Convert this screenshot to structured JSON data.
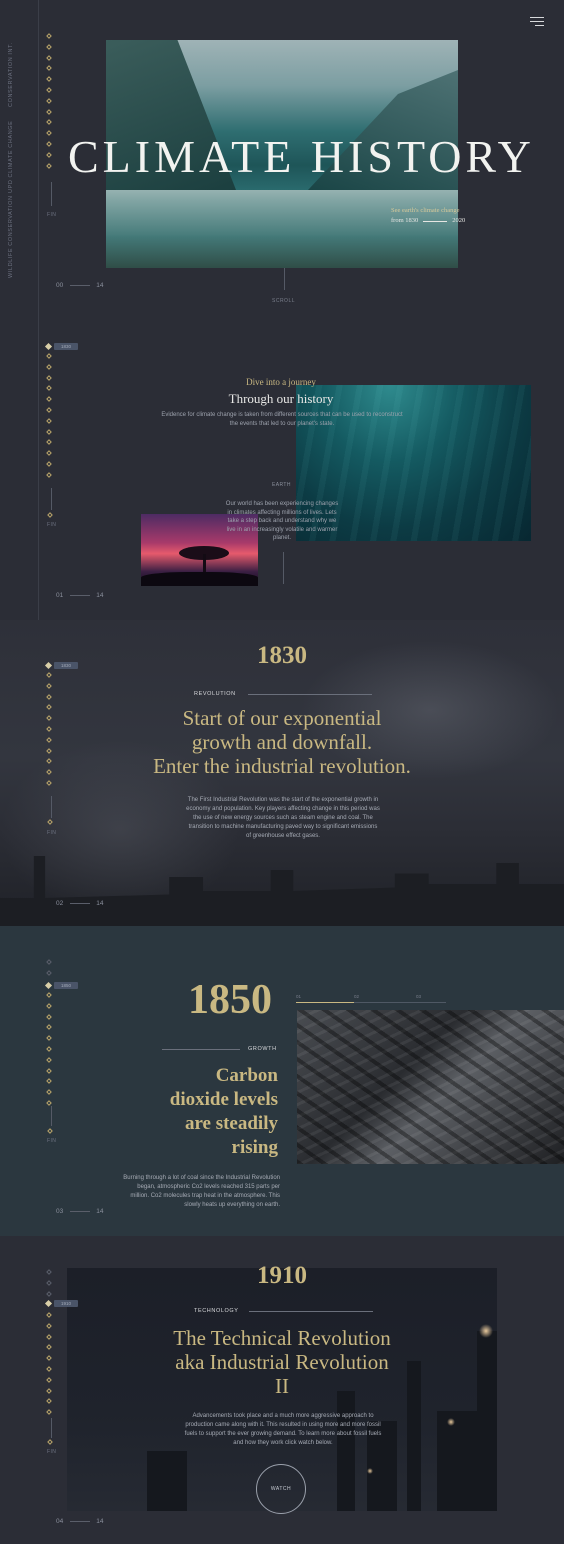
{
  "sidebar": {
    "labels": [
      "CONSERVATION INT.",
      "UPD CLIMATE CHANGE",
      "WILDLIFE CONSERVATION"
    ]
  },
  "hero": {
    "title": "CLIMATE HISTORY",
    "subtitle": "See earth's climate change",
    "range_from": "from 1830",
    "range_to": "2020",
    "scroll": "SCROLL",
    "fin": "FIN",
    "counter_current": "00",
    "counter_total": "14"
  },
  "journey": {
    "badge": "1830",
    "kicker": "Dive into a journey",
    "title": "Through our history",
    "text": "Evidence for climate change is taken from different sources that can be used to reconstruct the events that led to our planet's state.",
    "earth_tag": "EARTH",
    "text2": "Our world has been experiencing changes in climates affecting millions of lives. Lets take a step back and understand why we live in an increasingly volatile and warmer planet.",
    "fin": "FIN",
    "counter_current": "01",
    "counter_total": "14"
  },
  "s1830": {
    "badge": "1830",
    "year": "1830",
    "tag": "REVOLUTION",
    "headline_1": "Start of our exponential",
    "headline_2": "growth and downfall.",
    "headline_3": "Enter the industrial revolution.",
    "text": "The First Industrial Revolution was the start of the exponential growth in economy and population. Key players affecting change in this period was the use of new energy sources such as steam engine and coal. The transition to machine manufacturing paved way to significant emissions of greenhouse effect gases.",
    "fin": "FIN",
    "counter_current": "02",
    "counter_total": "14"
  },
  "s1850": {
    "badge": "1850",
    "year": "1850",
    "tag": "GROWTH",
    "headline_1": "Carbon",
    "headline_2": "dioxide levels",
    "headline_3": "are steadily",
    "headline_4": "rising",
    "slider_labels": [
      "01",
      "02",
      "03"
    ],
    "text": "Burning through a lot of coal since the Industrial Revolution began, atmospheric Co2 levels reached 315 parts per million. Co2 molecules trap heat in the atmosphere. This slowly heats up everything on earth.",
    "fin": "FIN",
    "counter_current": "03",
    "counter_total": "14"
  },
  "s1910": {
    "badge": "1910",
    "year": "1910",
    "tag": "TECHNOLOGY",
    "headline_1": "The Technical Revolution",
    "headline_2": "aka Industrial Revolution",
    "headline_3": "II",
    "text": "Advancements took place and a much more aggressive approach to production came along with it. This resulted in using more and more fossil fuels to support the ever growing demand. To learn more about fossil fuels and how they work click watch below.",
    "watch": "WATCH",
    "fin": "FIN",
    "counter_current": "04",
    "counter_total": "14"
  },
  "colors": {
    "background": "#2b2d36",
    "accent_gold": "#c9b882",
    "panel_1850": "#2b373f"
  }
}
